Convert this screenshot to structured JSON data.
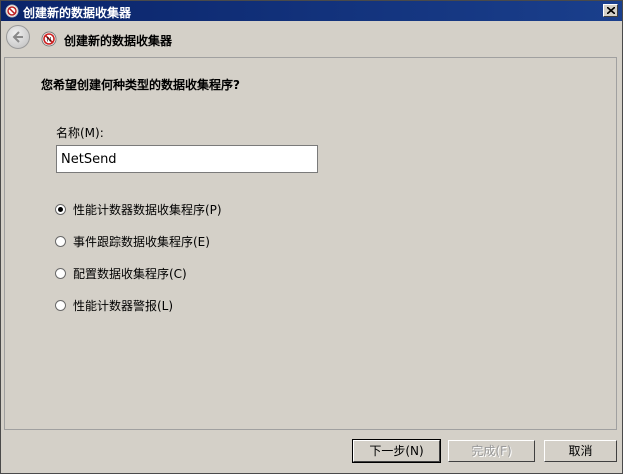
{
  "window": {
    "title": "创建新的数据收集器"
  },
  "header": {
    "title": "创建新的数据收集器"
  },
  "main": {
    "question": "您希望创建何种类型的数据收集程序?",
    "name_label": "名称(M):",
    "name_value": "NetSend",
    "options": [
      {
        "label": "性能计数器数据收集程序(P)",
        "checked": true
      },
      {
        "label": "事件跟踪数据收集程序(E)",
        "checked": false
      },
      {
        "label": "配置数据收集程序(C)",
        "checked": false
      },
      {
        "label": "性能计数器警报(L)",
        "checked": false
      }
    ]
  },
  "footer": {
    "next_label": "下一步(N)",
    "finish_label": "完成(F)",
    "cancel_label": "取消"
  },
  "colors": {
    "titlebar": "#0a246a",
    "background": "#d4d0c8"
  }
}
